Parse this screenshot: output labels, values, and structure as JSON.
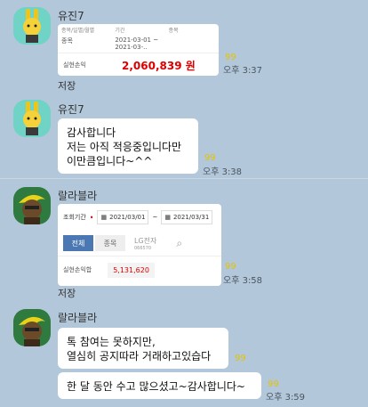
{
  "messages": [
    {
      "sender": "유진7",
      "card": {
        "col1_title": "종목/일별/월별",
        "col1_value": "종목",
        "col2_title": "기간",
        "col2_value": "2021-03-01 ~ 2021-03-..",
        "col3_title": "종목",
        "row_label": "실현손익",
        "row_value": "2,060,839 원"
      },
      "read": "99",
      "time": "오후 3:37",
      "label": "저장"
    },
    {
      "sender": "유진7",
      "text_lines": [
        "감사합니다",
        "저는 아직 적응중입니다만",
        "이만큼입니다~^^"
      ],
      "read": "99",
      "time": "오후 3:38"
    },
    {
      "sender": "랄라블라",
      "card": {
        "period_label": "조회기간",
        "date_from": "2021/03/01",
        "date_to": "2021/03/31",
        "btn_all": "전체",
        "btn_stock": "종목",
        "stock_name": "LG전자",
        "stock_code": "066570",
        "profit_label": "실현손익합",
        "profit_value": "5,131,620"
      },
      "read": "99",
      "time": "오후 3:58",
      "label": "저장"
    },
    {
      "sender": "랄라블라",
      "text_lines": [
        "톡 참여는 못하지만,",
        "열심히 공지따라 거래하고있습다"
      ],
      "text2": "한 달 동안 수고 많으셨고~감사합니다~",
      "read": "99",
      "read2": "99",
      "time": "오후 3:59"
    }
  ]
}
